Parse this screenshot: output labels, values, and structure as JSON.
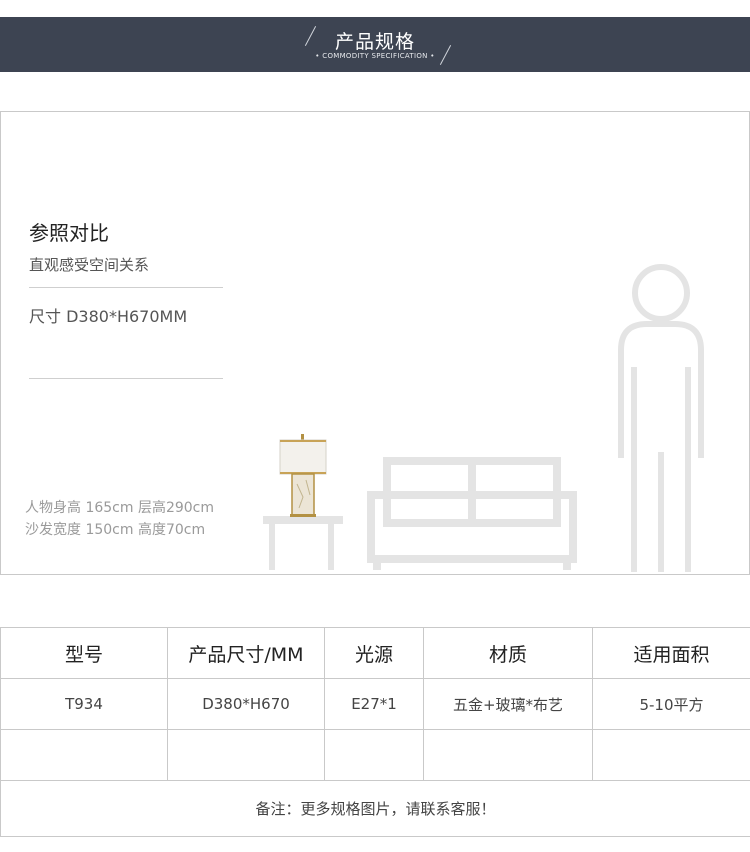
{
  "header": {
    "title": "产品规格",
    "subtitle": "• COMMODITY SPECIFICATION •"
  },
  "reference": {
    "title": "参照对比",
    "subtitle": "直观感受空间关系",
    "size_text": "尺寸  D380*H670MM",
    "scale_line1": "人物身高 165cm   层高290cm",
    "scale_line2": "沙发宽度 150cm   高度70cm"
  },
  "colors": {
    "banner": "#3d4452",
    "silhouette": "#e4e4e4",
    "lamp_shade": "#f3f1ec",
    "lamp_gold": "#b39143"
  },
  "table": {
    "headers": [
      "型号",
      "产品尺寸/MM",
      "光源",
      "材质",
      "适用面积"
    ],
    "rows": [
      [
        "T934",
        "D380*H670",
        "E27*1",
        "五金+玻璃*布艺",
        "5-10平方"
      ]
    ],
    "note": "备注：更多规格图片，请联系客服！"
  }
}
